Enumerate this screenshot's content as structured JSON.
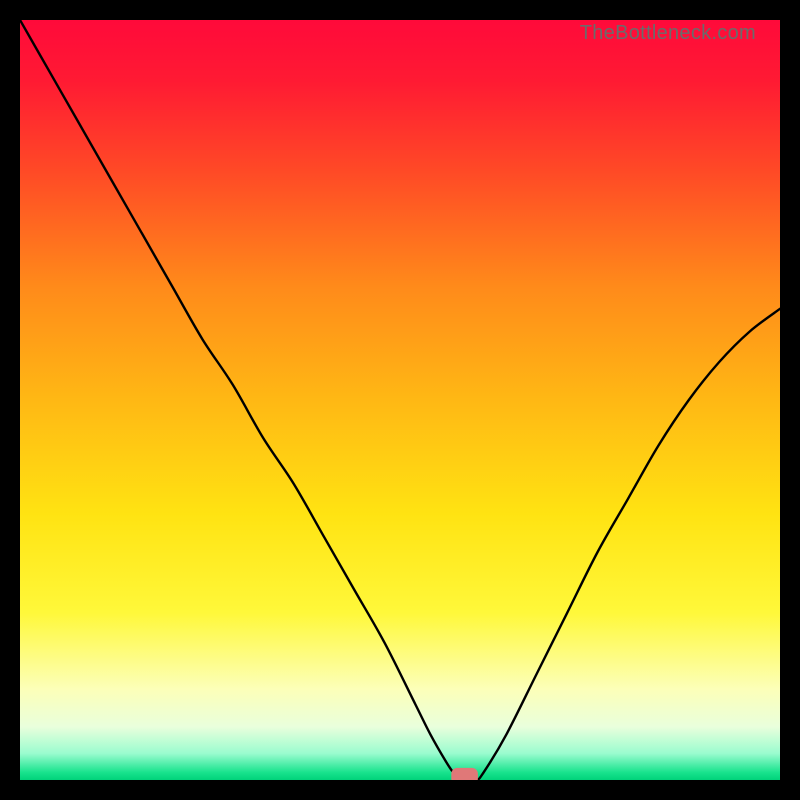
{
  "watermark": "TheBottleneck.com",
  "chart_data": {
    "type": "line",
    "title": "",
    "xlabel": "",
    "ylabel": "",
    "xlim": [
      0,
      100
    ],
    "ylim": [
      0,
      100
    ],
    "gradient_stops": [
      {
        "offset": 0.0,
        "color": "#ff0a3a"
      },
      {
        "offset": 0.08,
        "color": "#ff1a33"
      },
      {
        "offset": 0.2,
        "color": "#ff4a26"
      },
      {
        "offset": 0.35,
        "color": "#ff8a1a"
      },
      {
        "offset": 0.5,
        "color": "#ffb814"
      },
      {
        "offset": 0.65,
        "color": "#ffe312"
      },
      {
        "offset": 0.78,
        "color": "#fff83a"
      },
      {
        "offset": 0.88,
        "color": "#fcffb8"
      },
      {
        "offset": 0.93,
        "color": "#e9ffdc"
      },
      {
        "offset": 0.965,
        "color": "#9afccf"
      },
      {
        "offset": 0.99,
        "color": "#18e38d"
      },
      {
        "offset": 1.0,
        "color": "#00d27a"
      }
    ],
    "series": [
      {
        "name": "bottleneck-curve",
        "x": [
          0,
          4,
          8,
          12,
          16,
          20,
          24,
          28,
          32,
          36,
          40,
          44,
          48,
          52,
          54,
          56,
          57,
          58,
          60,
          61,
          64,
          68,
          72,
          76,
          80,
          84,
          88,
          92,
          96,
          100
        ],
        "y": [
          100,
          93,
          86,
          79,
          72,
          65,
          58,
          52,
          45,
          39,
          32,
          25,
          18,
          10,
          6,
          2.5,
          1.0,
          0.0,
          0.0,
          1.0,
          6,
          14,
          22,
          30,
          37,
          44,
          50,
          55,
          59,
          62
        ]
      }
    ],
    "marker": {
      "x": 58.5,
      "y": 0.5,
      "width": 3.5,
      "height": 2.2,
      "color": "#e07878"
    }
  }
}
